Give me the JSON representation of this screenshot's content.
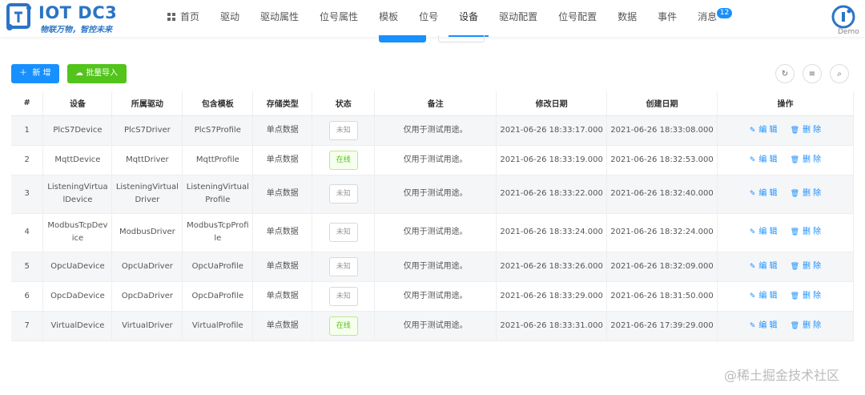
{
  "brand": {
    "title": "IOT DC3",
    "slogan": "物联万物，智控未来"
  },
  "nav": [
    {
      "label": "首页"
    },
    {
      "label": "驱动"
    },
    {
      "label": "驱动属性"
    },
    {
      "label": "位号属性"
    },
    {
      "label": "模板"
    },
    {
      "label": "位号"
    },
    {
      "label": "设备"
    },
    {
      "label": "驱动配置"
    },
    {
      "label": "位号配置"
    },
    {
      "label": "数据"
    },
    {
      "label": "事件"
    },
    {
      "label": "消息"
    }
  ],
  "nav_badge": "12",
  "user": {
    "name": "Demo"
  },
  "toolbar": {
    "add_label": "新 增",
    "import_label": "批量导入"
  },
  "tools": [
    {
      "icon": "refresh-icon"
    },
    {
      "icon": "filter-icon"
    },
    {
      "icon": "search-icon"
    }
  ],
  "colors": {
    "primary": "#1890ff",
    "success": "#52c41a"
  },
  "table": {
    "columns": [
      "#",
      "设备",
      "所属驱动",
      "包含模板",
      "存储类型",
      "状态",
      "备注",
      "修改日期",
      "创建日期",
      "操作"
    ],
    "rows": [
      {
        "no": "1",
        "device": "PlcS7Device",
        "driver": "PlcS7Driver",
        "profile": "PlcS7Profile",
        "storage": "单点数据",
        "status": "未知",
        "online": false,
        "remark": "仅用于测试用途。",
        "updated": "2021-06-26 18:33:17.000",
        "created": "2021-06-26 18:33:08.000"
      },
      {
        "no": "2",
        "device": "MqttDevice",
        "driver": "MqttDriver",
        "profile": "MqttProfile",
        "storage": "单点数据",
        "status": "在线",
        "online": true,
        "remark": "仅用于测试用途。",
        "updated": "2021-06-26 18:33:19.000",
        "created": "2021-06-26 18:32:53.000"
      },
      {
        "no": "3",
        "device": "ListeningVirtualDevice",
        "driver": "ListeningVirtualDriver",
        "profile": "ListeningVirtualProfile",
        "storage": "单点数据",
        "status": "未知",
        "online": false,
        "remark": "仅用于测试用途。",
        "updated": "2021-06-26 18:33:22.000",
        "created": "2021-06-26 18:32:40.000"
      },
      {
        "no": "4",
        "device": "ModbusTcpDevice",
        "driver": "ModbusDriver",
        "profile": "ModbusTcpProfile",
        "storage": "单点数据",
        "status": "未知",
        "online": false,
        "remark": "仅用于测试用途。",
        "updated": "2021-06-26 18:33:24.000",
        "created": "2021-06-26 18:32:24.000"
      },
      {
        "no": "5",
        "device": "OpcUaDevice",
        "driver": "OpcUaDriver",
        "profile": "OpcUaProfile",
        "storage": "单点数据",
        "status": "未知",
        "online": false,
        "remark": "仅用于测试用途。",
        "updated": "2021-06-26 18:33:26.000",
        "created": "2021-06-26 18:32:09.000"
      },
      {
        "no": "6",
        "device": "OpcDaDevice",
        "driver": "OpcDaDriver",
        "profile": "OpcDaProfile",
        "storage": "单点数据",
        "status": "未知",
        "online": false,
        "remark": "仅用于测试用途。",
        "updated": "2021-06-26 18:33:29.000",
        "created": "2021-06-26 18:31:50.000"
      },
      {
        "no": "7",
        "device": "VirtualDevice",
        "driver": "VirtualDriver",
        "profile": "VirtualProfile",
        "storage": "单点数据",
        "status": "在线",
        "online": true,
        "remark": "仅用于测试用途。",
        "updated": "2021-06-26 18:33:31.000",
        "created": "2021-06-26 17:39:29.000"
      }
    ],
    "actions": {
      "edit": "编 辑",
      "delete": "删 除"
    }
  },
  "watermark": "@稀土掘金技术社区"
}
